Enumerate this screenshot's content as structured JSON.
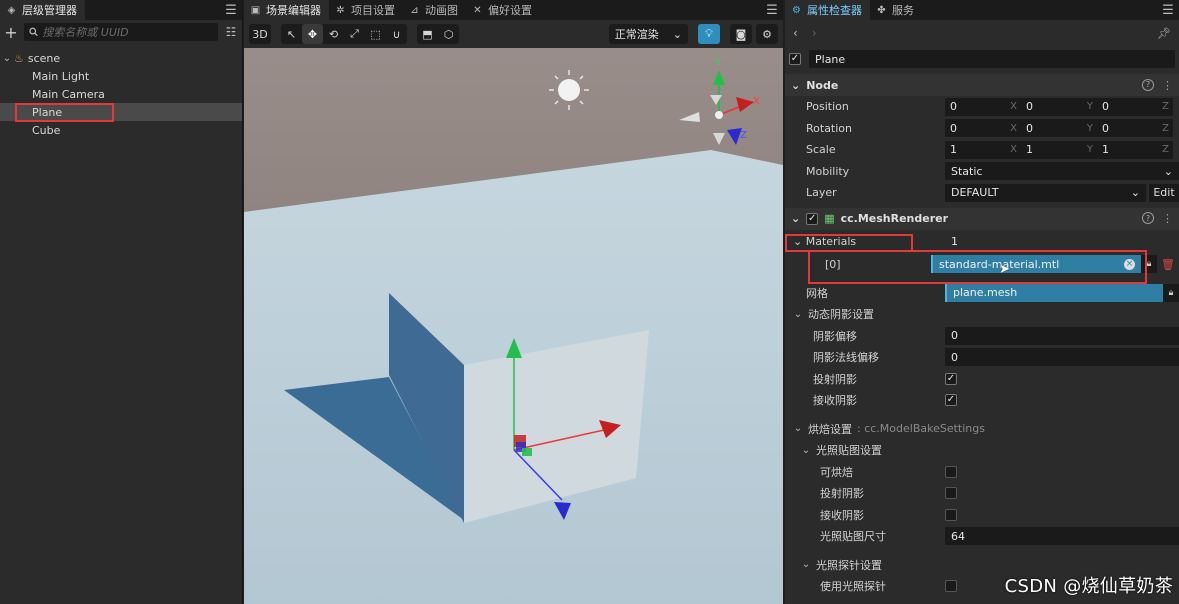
{
  "hierarchy": {
    "tab_label": "层级管理器",
    "search_placeholder": "搜索名称或 UUID",
    "root": "scene",
    "items": [
      "Main Light",
      "Main Camera",
      "Plane",
      "Cube"
    ],
    "selected": "Plane"
  },
  "scene": {
    "tabs": [
      "场景编辑器",
      "项目设置",
      "动画图",
      "偏好设置"
    ],
    "toolbar": {
      "mode_3d": "3D",
      "render_mode": "正常渲染"
    },
    "gizmo_axes": {
      "x": "X",
      "y": "Y",
      "z": "Z"
    }
  },
  "inspector": {
    "tabs": [
      "属性检查器",
      "服务"
    ],
    "node_name": "Plane",
    "node_section": "Node",
    "position": {
      "label": "Position",
      "x": "0",
      "y": "0",
      "z": "0"
    },
    "rotation": {
      "label": "Rotation",
      "x": "0",
      "y": "0",
      "z": "0"
    },
    "scale": {
      "label": "Scale",
      "x": "1",
      "y": "1",
      "z": "1"
    },
    "mobility": {
      "label": "Mobility",
      "value": "Static"
    },
    "layer": {
      "label": "Layer",
      "value": "DEFAULT",
      "edit": "Edit"
    },
    "component": "cc.MeshRenderer",
    "materials": {
      "label": "Materials",
      "count": "1",
      "item_index": "[0]",
      "item_value": "standard-material.mtl"
    },
    "mesh": {
      "label": "网格",
      "value": "plane.mesh"
    },
    "dynamic_shadow": {
      "title": "动态阴影设置",
      "shadow_bias": {
        "label": "阴影偏移",
        "value": "0"
      },
      "shadow_normal_bias": {
        "label": "阴影法线偏移",
        "value": "0"
      },
      "cast_shadows": {
        "label": "投射阴影",
        "checked": true
      },
      "receive_shadows": {
        "label": "接收阴影",
        "checked": true
      }
    },
    "bake": {
      "title": "烘焙设置",
      "subtitle": ": cc.ModelBakeSettings",
      "lightmap": {
        "title": "光照贴图设置",
        "bakeable": {
          "label": "可烘焙",
          "checked": false
        },
        "cast_shadow": {
          "label": "投射阴影",
          "checked": false
        },
        "receive_shadow": {
          "label": "接收阴影",
          "checked": false
        },
        "size": {
          "label": "光照贴图尺寸",
          "value": "64"
        }
      },
      "probe": {
        "title": "光照探针设置",
        "use_probe": {
          "label": "使用光照探针",
          "checked": false
        }
      }
    }
  },
  "watermark": "CSDN @烧仙草奶茶"
}
